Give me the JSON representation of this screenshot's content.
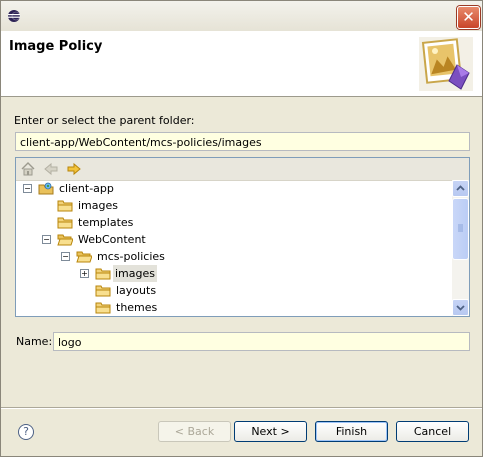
{
  "window": {
    "close_glyph": "✕"
  },
  "banner": {
    "title": "Image Policy",
    "image": "image-policy-wizard-icon"
  },
  "folder": {
    "prompt": "Enter or select the parent folder:",
    "path_value": "client-app/WebContent/mcs-policies/images"
  },
  "tree_toolbar": {
    "icons": [
      "home-icon",
      "back-icon",
      "forward-icon"
    ]
  },
  "tree": {
    "items": [
      {
        "label": "client-app",
        "icon": "project-icon",
        "toggle": "−"
      },
      {
        "label": "images",
        "icon": "folder-icon",
        "toggle": ""
      },
      {
        "label": "templates",
        "icon": "folder-icon",
        "toggle": ""
      },
      {
        "label": "WebContent",
        "icon": "folder-icon",
        "toggle": "−"
      },
      {
        "label": "mcs-policies",
        "icon": "folder-icon",
        "toggle": "−"
      },
      {
        "label": "images",
        "icon": "folder-icon",
        "toggle": "+",
        "selected": true
      },
      {
        "label": "layouts",
        "icon": "folder-icon",
        "toggle": ""
      },
      {
        "label": "themes",
        "icon": "folder-icon",
        "toggle": ""
      }
    ]
  },
  "name": {
    "label": "Name:",
    "value": "logo"
  },
  "buttons": {
    "back": "< Back",
    "next": "Next >",
    "finish": "Finish",
    "cancel": "Cancel",
    "help": "?"
  }
}
